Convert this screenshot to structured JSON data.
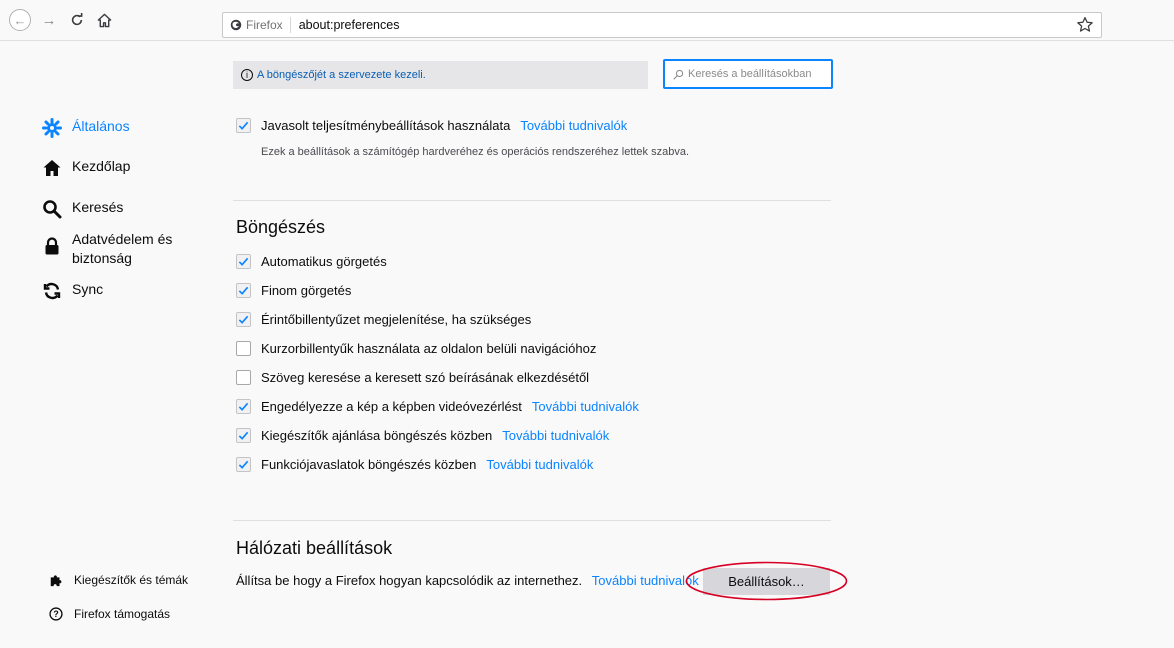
{
  "browser": {
    "identity_label": "Firefox",
    "url": "about:preferences"
  },
  "policy_banner": {
    "text": "A böngészőjét a szervezete kezeli."
  },
  "search": {
    "placeholder": "Keresés a beállításokban"
  },
  "sidebar": {
    "items": [
      {
        "label": "Általános",
        "icon": "gear-icon",
        "active": true
      },
      {
        "label": "Kezdőlap",
        "icon": "home-icon"
      },
      {
        "label": "Keresés",
        "icon": "search-icon"
      },
      {
        "label": "Adatvédelem és\nbiztonság",
        "icon": "lock-icon"
      },
      {
        "label": "Sync",
        "icon": "sync-icon"
      }
    ],
    "footer": [
      {
        "label": "Kiegészítők és témák",
        "icon": "puzzle-icon"
      },
      {
        "label": "Firefox támogatás",
        "icon": "help-icon"
      }
    ]
  },
  "performance": {
    "label": "Javasolt teljesítménybeállítások használata",
    "checked": true,
    "link": "További tudnivalók",
    "description": "Ezek a beállítások a számítógép hardveréhez és operációs rendszeréhez lettek szabva."
  },
  "browsing": {
    "title": "Böngészés",
    "options": [
      {
        "label": "Automatikus görgetés",
        "checked": true
      },
      {
        "label": "Finom görgetés",
        "checked": true
      },
      {
        "label": "Érintőbillentyűzet megjelenítése, ha szükséges",
        "checked": true
      },
      {
        "label": "Kurzorbillentyűk használata az oldalon belüli navigációhoz",
        "checked": false
      },
      {
        "label": "Szöveg keresése a keresett szó beírásának elkezdésétől",
        "checked": false
      },
      {
        "label": "Engedélyezze a kép a képben videóvezérlést",
        "checked": true,
        "link": "További tudnivalók"
      },
      {
        "label": "Kiegészítők ajánlása böngészés közben",
        "checked": true,
        "link": "További tudnivalók"
      },
      {
        "label": "Funkciójavaslatok böngészés közben",
        "checked": true,
        "link": "További tudnivalók"
      }
    ]
  },
  "network": {
    "title": "Hálózati beállítások",
    "description": "Állítsa be hogy a Firefox hogyan kapcsolódik az internethez.",
    "link": "További tudnivalók",
    "button": "Beállítások…"
  },
  "colors": {
    "accent": "#0a84ff",
    "highlight": "#d70022"
  }
}
